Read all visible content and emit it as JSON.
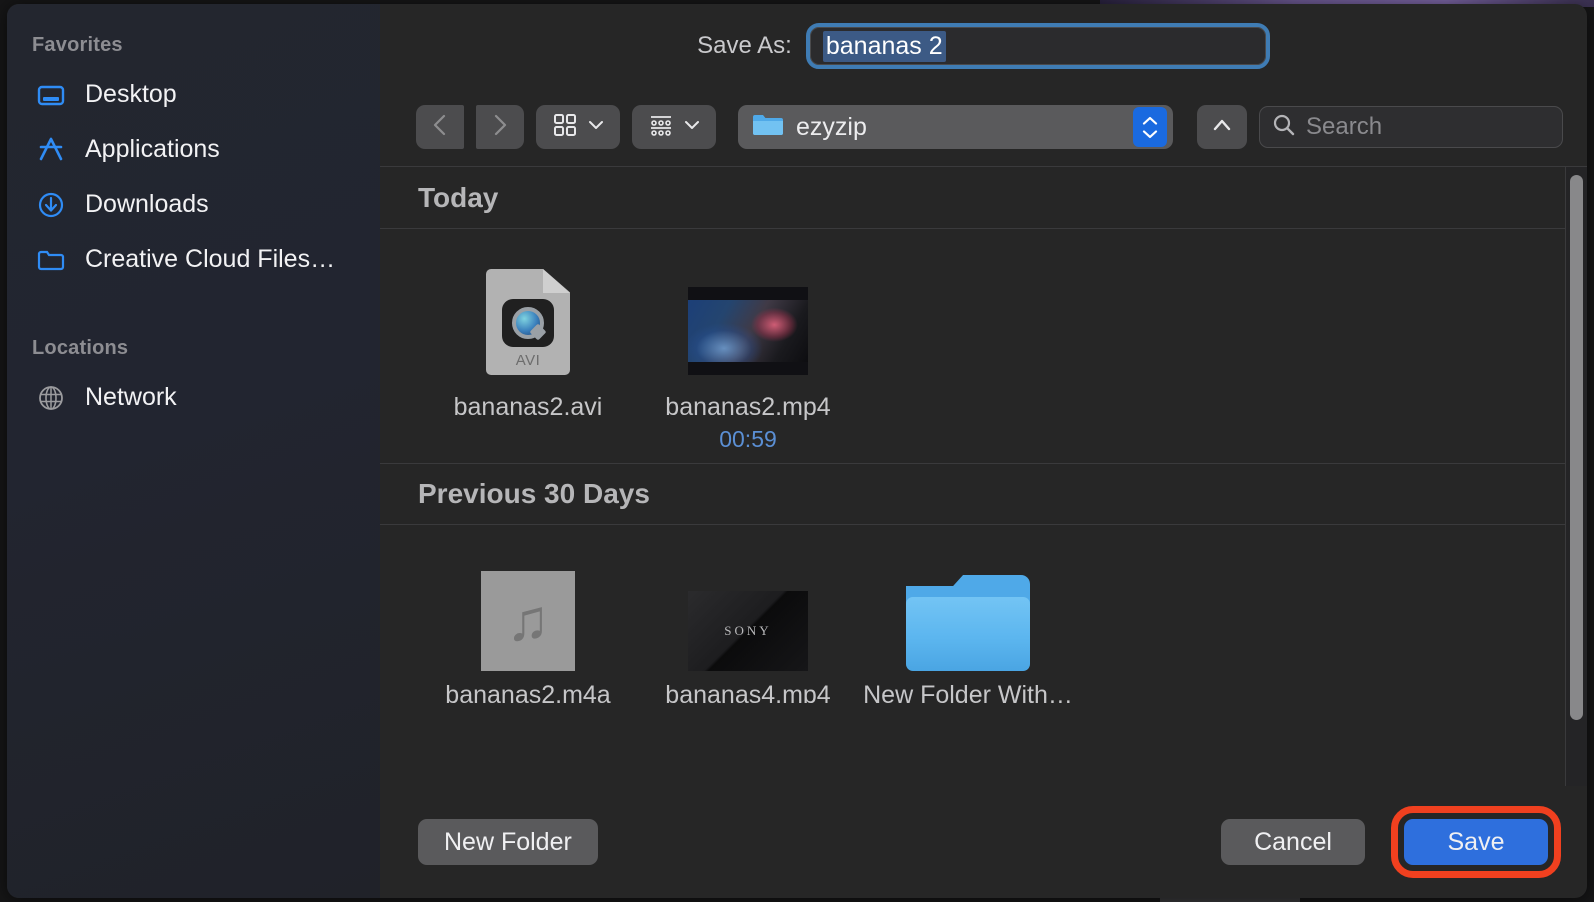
{
  "window": {
    "title": "Save dialog"
  },
  "sidebar": {
    "sections": [
      {
        "header": "Favorites",
        "items": [
          {
            "label": "Desktop",
            "icon": "desktop-icon"
          },
          {
            "label": "Applications",
            "icon": "applications-icon"
          },
          {
            "label": "Downloads",
            "icon": "downloads-icon"
          },
          {
            "label": "Creative Cloud Files…",
            "icon": "folder-icon"
          }
        ]
      },
      {
        "header": "Locations",
        "items": [
          {
            "label": "Network",
            "icon": "globe-icon"
          }
        ]
      }
    ]
  },
  "header": {
    "save_as_label": "Save As:",
    "filename_value": "bananas 2"
  },
  "toolbar": {
    "back_icon": "chevron-left-icon",
    "forward_icon": "chevron-right-icon",
    "view_grid_icon": "grid-view-icon",
    "view_group_icon": "group-view-icon",
    "chevron_icon": "chevron-down-icon",
    "path_label": "ezyzip",
    "path_folder_icon": "folder-icon",
    "stepper_icon": "up-down-stepper-icon",
    "up_icon": "chevron-up-icon",
    "search_icon": "search-icon",
    "search_placeholder": "Search",
    "search_value": ""
  },
  "filelist": {
    "sections": [
      {
        "header": "Today",
        "items": [
          {
            "label": "bananas2.avi",
            "sub": "",
            "thumb": "avi-document-icon"
          },
          {
            "label": "bananas2.mp4",
            "sub": "00:59",
            "thumb": "video-thumbnail"
          }
        ]
      },
      {
        "header": "Previous 30 Days",
        "items": [
          {
            "label": "bananas2.m4a",
            "sub": "",
            "thumb": "music-thumbnail"
          },
          {
            "label": "bananas4.mp4",
            "sub": "",
            "thumb": "sony-video-thumbnail"
          },
          {
            "label": "New Folder With…",
            "sub": "",
            "thumb": "folder-icon"
          }
        ]
      }
    ]
  },
  "footer": {
    "new_folder_label": "New Folder",
    "cancel_label": "Cancel",
    "save_label": "Save"
  },
  "colors": {
    "accent_blue": "#2e6fdd",
    "highlight_red": "#f0401f",
    "sidebar_icon_blue": "#2f8cf5",
    "duration_blue": "#5b8fd4",
    "selection_blue": "#3c5a85"
  }
}
